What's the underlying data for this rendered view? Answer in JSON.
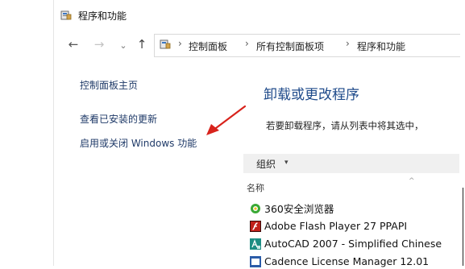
{
  "window": {
    "title": "程序和功能"
  },
  "address": {
    "breadcrumb": [
      "控制面板",
      "所有控制面板项",
      "程序和功能"
    ],
    "separator": "›"
  },
  "nav": {
    "back": "←",
    "forward": "→",
    "recent": "⌄",
    "up": "↑"
  },
  "tasks": {
    "home": "控制面板主页",
    "view_updates": "查看已安装的更新",
    "windows_features": "启用或关闭 Windows 功能"
  },
  "main": {
    "heading": "卸载或更改程序",
    "description": "若要卸载程序，请从列表中将其选中，"
  },
  "toolbar": {
    "organize": "组织",
    "caret": "▾"
  },
  "list": {
    "column_name": "名称",
    "sort_indicator": "^",
    "items": [
      {
        "label": "360安全浏览器",
        "icon": "360-browser-icon",
        "color": "#3aa935"
      },
      {
        "label": "Adobe Flash Player 27 PPAPI",
        "icon": "flash-player-icon",
        "color": "#c0201a"
      },
      {
        "label": "AutoCAD 2007 - Simplified Chinese",
        "icon": "autocad-icon",
        "color": "#1d8d83"
      },
      {
        "label": "Cadence License Manager 12.01",
        "icon": "cadence-icon",
        "color": "#2b5ca8"
      }
    ]
  },
  "colors": {
    "link": "#1f3a68",
    "heading": "#1e4a8a",
    "annotation_arrow": "#d8231c"
  }
}
